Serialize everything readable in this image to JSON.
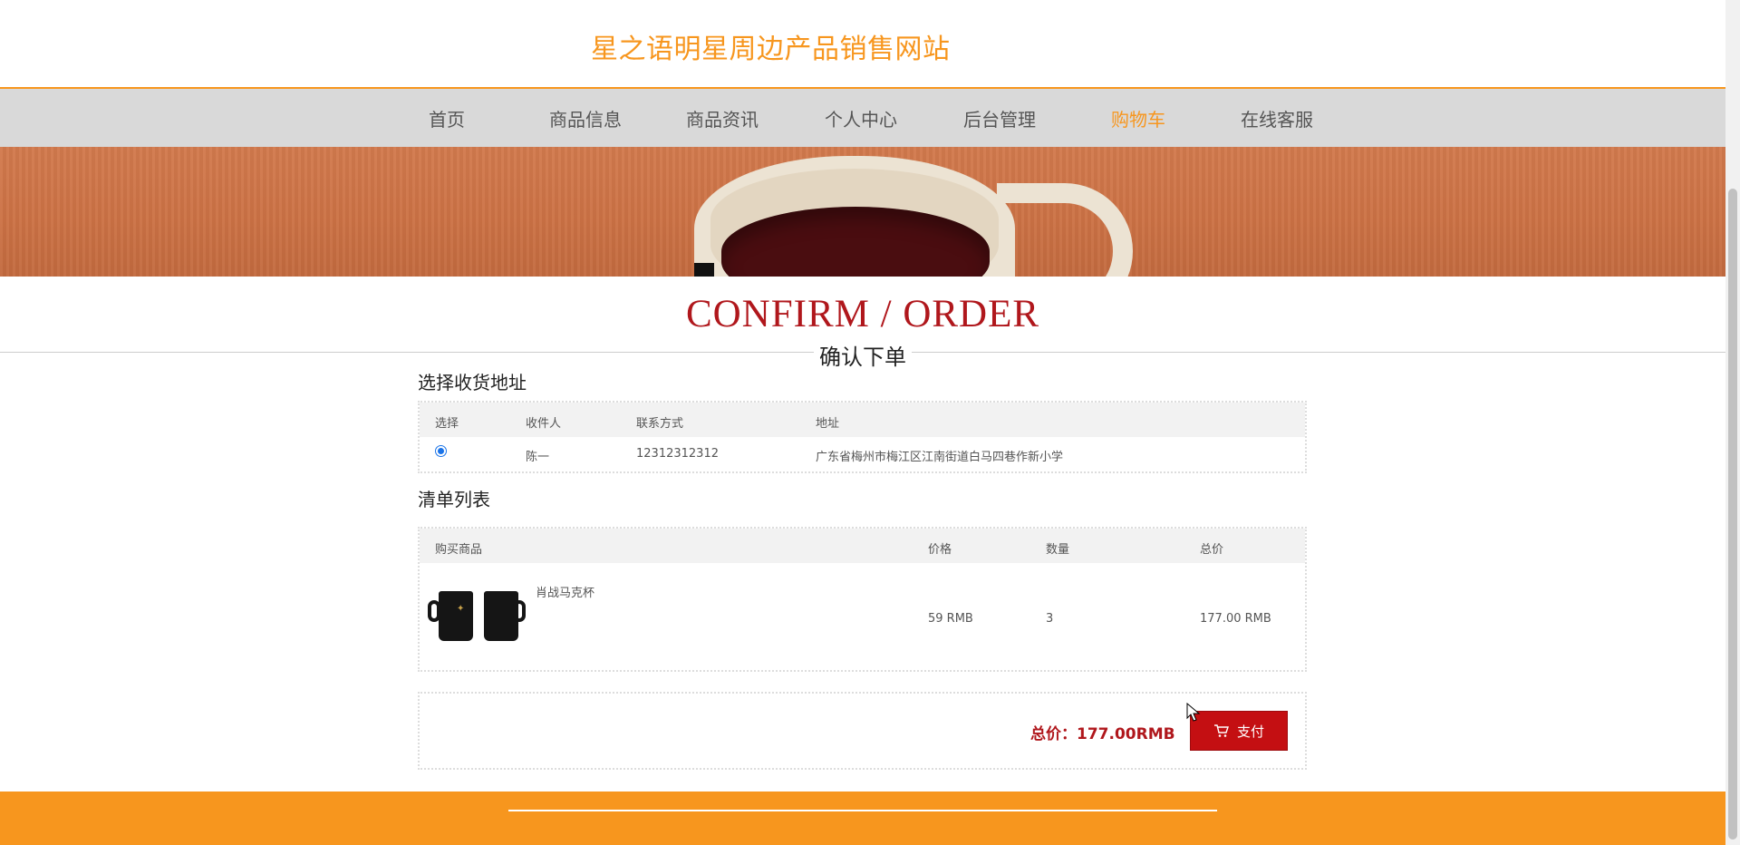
{
  "site": {
    "title": "星之语明星周边产品销售网站"
  },
  "nav": {
    "items": [
      {
        "label": "首页"
      },
      {
        "label": "商品信息"
      },
      {
        "label": "商品资讯"
      },
      {
        "label": "个人中心"
      },
      {
        "label": "后台管理"
      },
      {
        "label": "购物车",
        "active": true
      },
      {
        "label": "在线客服"
      }
    ]
  },
  "page": {
    "title_en": "CONFIRM / ORDER",
    "title_cn": "确认下单"
  },
  "address_section": {
    "heading": "选择收货地址",
    "columns": [
      "选择",
      "收件人",
      "联系方式",
      "地址"
    ],
    "rows": [
      {
        "selected": true,
        "recipient": "陈一",
        "phone": "12312312312",
        "address": "广东省梅州市梅江区江南街道白马四巷作新小学"
      }
    ]
  },
  "items_section": {
    "heading": "清单列表",
    "columns": [
      "购买商品",
      "价格",
      "数量",
      "总价"
    ],
    "rows": [
      {
        "name": "肖战马克杯",
        "price": "59 RMB",
        "quantity": "3",
        "total": "177.00 RMB"
      }
    ]
  },
  "summary": {
    "total_text": "总价：177.00RMB",
    "pay_label": "支付"
  },
  "colors": {
    "brand": "#f7961e",
    "accent_red": "#b0171c",
    "pay_button": "#c40f12",
    "nav_bg": "#d9d9d9"
  }
}
